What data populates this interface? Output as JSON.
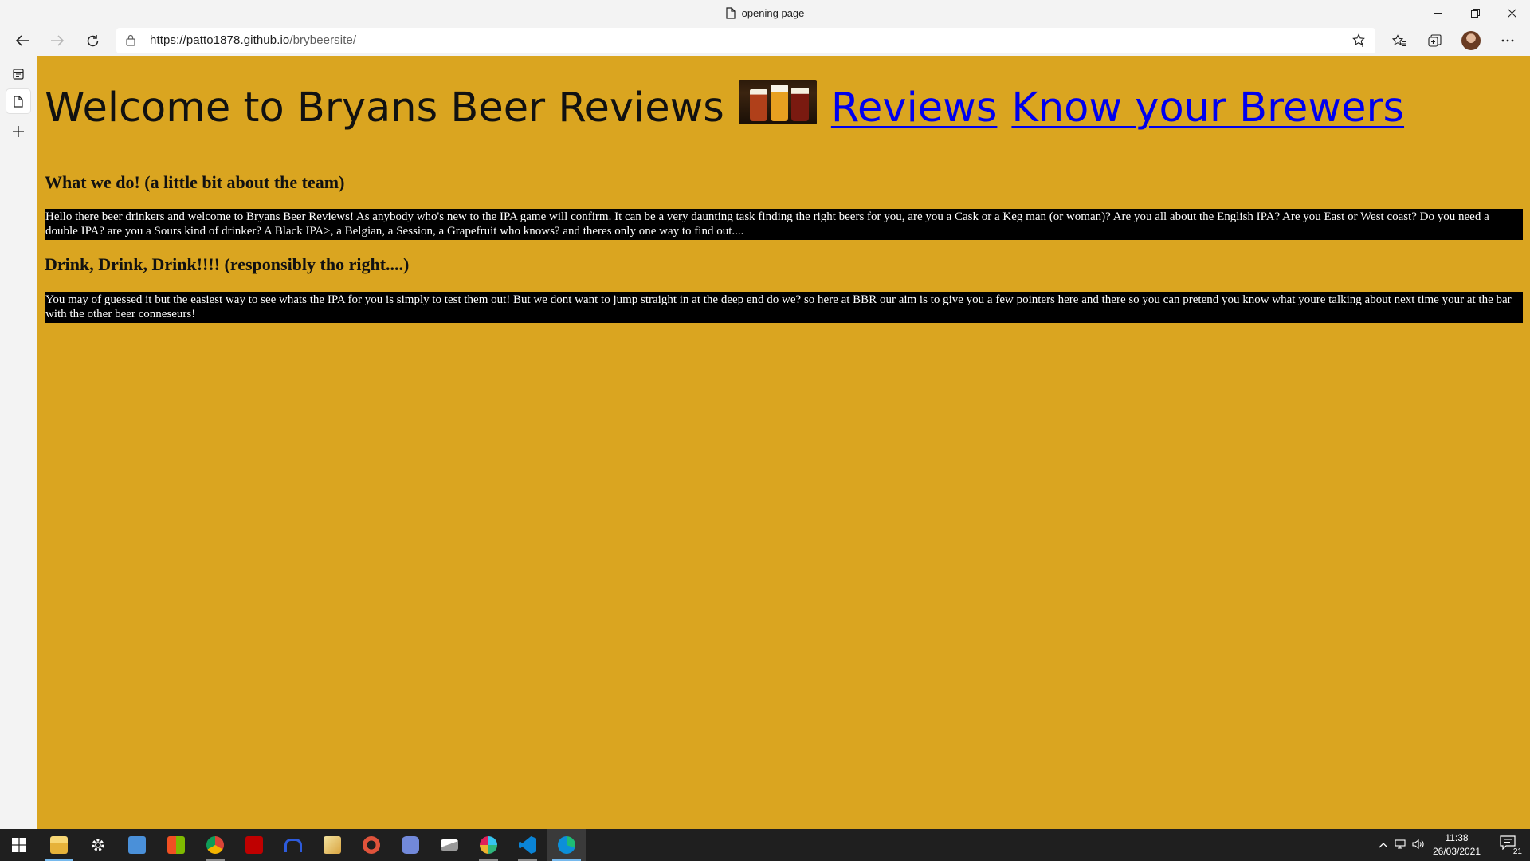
{
  "browser": {
    "tab_title": "opening page",
    "url_domain": "https://patto1878.github.io",
    "url_path": "/brybeersite/"
  },
  "page": {
    "title": "Welcome to Bryans Beer Reviews",
    "nav": [
      "Reviews",
      "Know your Brewers"
    ],
    "section1_heading": "What we do! (a little bit about the team)",
    "section1_text": "Hello there beer drinkers and welcome to Bryans Beer Reviews! As anybody who's new to the IPA game will confirm. It can be a very daunting task finding the right beers for you, are you a Cask or a Keg man (or woman)? Are you all about the English IPA? Are you East or West coast? Do you need a double IPA? are you a Sours kind of drinker? A Black IPA>, a Belgian, a Session, a Grapefruit who knows? and theres only one way to find out....",
    "section2_heading": "Drink, Drink, Drink!!!! (responsibly tho right....)",
    "section2_text": "You may of guessed it but the easiest way to see whats the IPA for you is simply to test them out! But we dont want to jump straight in at the deep end do we? so here at BBR our aim is to give you a few pointers here and there so you can pretend you know what youre talking about next time your at the bar with the other beer conneseurs!",
    "background_color": "#daa520",
    "link_color": "#0000ee"
  },
  "taskbar": {
    "time": "11:38",
    "date": "26/03/2021",
    "notification_count": "21",
    "apps": [
      "file-explorer",
      "settings",
      "news",
      "store",
      "chrome",
      "filezilla",
      "malwarebytes",
      "notes",
      "ccleaner",
      "discord",
      "app",
      "slack",
      "vscode",
      "edge"
    ]
  }
}
